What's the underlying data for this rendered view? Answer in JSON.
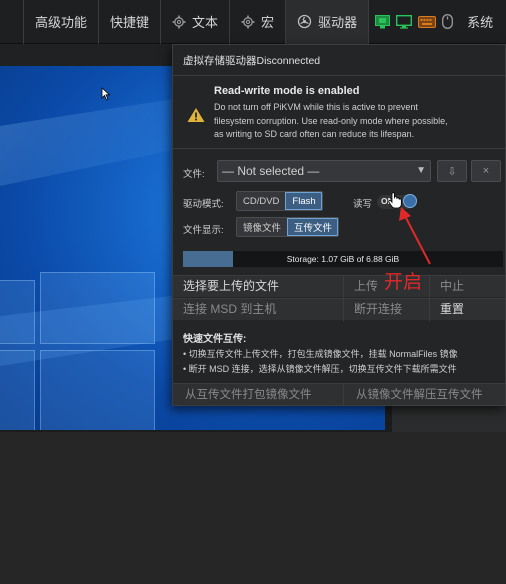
{
  "menubar": {
    "items": [
      {
        "label": "高级功能",
        "icon": ""
      },
      {
        "label": "快捷键",
        "icon": ""
      },
      {
        "label": "文本",
        "icon": "gear-icon"
      },
      {
        "label": "宏",
        "icon": "gear-icon"
      },
      {
        "label": "驱动器",
        "icon": "drive-icon"
      }
    ],
    "status_icons": [
      "ethernet-icon",
      "monitor-icon",
      "keyboard-icon",
      "mouse-icon"
    ],
    "system_label": "系统",
    "status_colors": {
      "ok": "#29c45a",
      "warn": "#d97b1e"
    }
  },
  "msd": {
    "title": "虚拟存储驱动器Disconnected",
    "warning": {
      "title": "Read-write mode is enabled",
      "lines": [
        "Do not turn off PiKVM while this is active to prevent",
        "filesystem corruption. Use read-only mode where possible,",
        "as writing to SD card often can reduce its lifespan."
      ]
    },
    "file_label": "文件:",
    "file_select": "— Not selected —",
    "download_btn": "⇩",
    "remove_btn": "×",
    "drive_mode_label": "驱动模式:",
    "drive_modes": [
      "CD/DVD",
      "Flash"
    ],
    "drive_mode_selected": "Flash",
    "rw_label": "读写",
    "rw_toggle": "ON",
    "file_display_label": "文件显示:",
    "file_display_modes": [
      "镜像文件",
      "互传文件"
    ],
    "file_display_selected": "互传文件",
    "storage_text": "Storage: 1.07 GiB of 6.88 GiB",
    "storage_used_fraction": 0.155,
    "actions": {
      "select_upload": "选择要上传的文件",
      "upload": "上传",
      "abort": "中止",
      "connect": "连接 MSD 到主机",
      "disconnect": "断开连接",
      "reset": "重置"
    },
    "tips": {
      "title": "快速文件互传:",
      "lines": [
        "• 切换互传文件上传文件，打包生成镜像文件，挂载 NormalFiles 镜像",
        "• 断开 MSD 连接，选择从镜像文件解压，切换互传文件下载所需文件"
      ]
    },
    "bottom": {
      "pack": "从互传文件打包镜像文件",
      "unpack": "从镜像文件解压互传文件"
    }
  },
  "annotation": {
    "text": "开启",
    "color": "#e02a2a"
  }
}
